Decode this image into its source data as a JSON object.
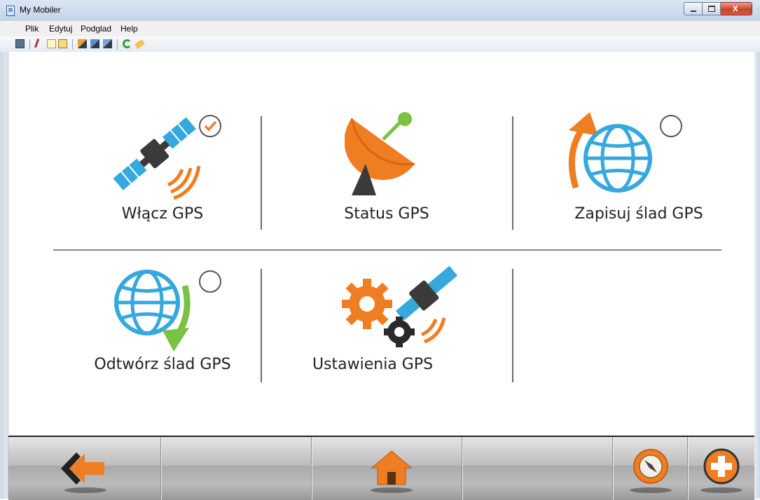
{
  "window": {
    "title": "My Mobiler"
  },
  "menu": [
    {
      "label": "Plik"
    },
    {
      "label": "Edytuj"
    },
    {
      "label": "Podglad"
    },
    {
      "label": "Help"
    }
  ],
  "toolbar": {
    "icons": [
      "device-icon",
      "cut-icon",
      "copy-icon",
      "paste-icon",
      "screen1-icon",
      "screen2-icon",
      "screen3-icon",
      "refresh-icon",
      "clean-icon"
    ]
  },
  "tiles": [
    {
      "label": "Włącz GPS",
      "checked": true
    },
    {
      "label": "Status GPS"
    },
    {
      "label": "Zapisuj ślad GPS",
      "checked": false
    },
    {
      "label": "Odtwórz ślad GPS",
      "checked": false
    },
    {
      "label": "Ustawienia GPS"
    }
  ],
  "bottom_nav": [
    "back-arrow-icon",
    "home-icon",
    "compass-icon",
    "add-icon"
  ],
  "colors": {
    "accent_orange": "#ef7d22",
    "accent_blue": "#35a8de",
    "accent_green": "#7cc242",
    "dark": "#3a3a3a"
  }
}
